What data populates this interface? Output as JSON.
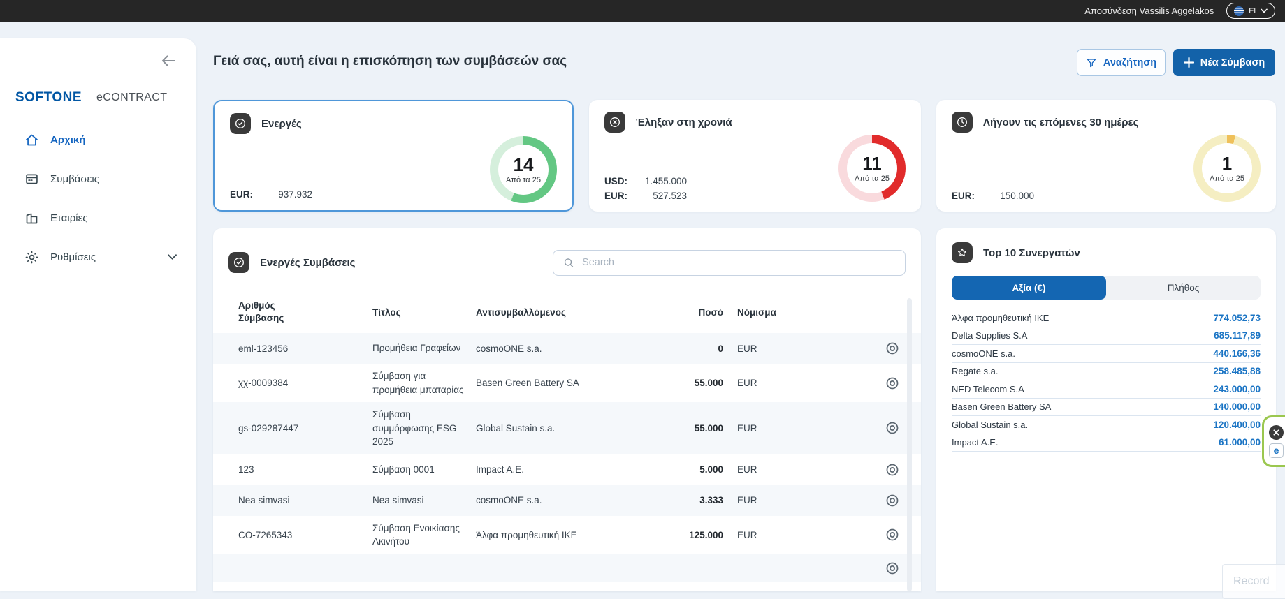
{
  "topbar": {
    "logout_label": "Αποσύνδεση Vassilis Aggelakos",
    "language": "El"
  },
  "sidebar": {
    "brand_name": "SOFTONE",
    "brand_product": "eCONTRACT",
    "items": [
      {
        "label": "Αρχική",
        "active": true
      },
      {
        "label": "Συμβάσεις",
        "active": false
      },
      {
        "label": "Εταιρίες",
        "active": false
      },
      {
        "label": "Ρυθμίσεις",
        "active": false
      }
    ]
  },
  "header": {
    "greeting": "Γειά σας, αυτή είναι η επισκόπηση των συμβάσεών σας",
    "search_button": "Αναζήτηση",
    "new_contract_button": "Νέα Σύμβαση"
  },
  "cards": [
    {
      "title": "Ενεργές",
      "count": "14",
      "of_label": "Από τα 25",
      "percent": 56,
      "ring_color": "#63c783",
      "ring_bg": "#d5efdc",
      "amounts": [
        {
          "currency": "EUR:",
          "value": "937.932"
        }
      ]
    },
    {
      "title": "Έληξαν στη χρονιά",
      "count": "11",
      "of_label": "Από τα 25",
      "percent": 44,
      "ring_color": "#e12b2b",
      "ring_bg": "#f9dadd",
      "amounts": [
        {
          "currency": "USD:",
          "value": "1.455.000"
        },
        {
          "currency": "EUR:",
          "value": "527.523"
        }
      ]
    },
    {
      "title": "Λήγουν τις επόμενες 30 ημέρες",
      "count": "1",
      "of_label": "Από τα 25",
      "percent": 4,
      "ring_color": "#efc05a",
      "ring_bg": "#f5eec2",
      "amounts": [
        {
          "currency": "EUR:",
          "value": "150.000"
        }
      ]
    }
  ],
  "table": {
    "title": "Ενεργές Συμβάσεις",
    "search_placeholder": "Search",
    "columns": {
      "number": "Αριθμός Σύμβασης",
      "title": "Τίτλος",
      "counterparty": "Αντισυμβαλλόμενος",
      "amount": "Ποσό",
      "currency": "Νόμισμα"
    },
    "rows": [
      {
        "number": "eml-123456",
        "title": "Προμήθεια Γραφείων",
        "counterparty": "cosmoONE s.a.",
        "amount": "0",
        "currency": "EUR"
      },
      {
        "number": "χχ-0009384",
        "title": "Σύμβαση για προμήθεια μπαταρίας",
        "counterparty": "Basen Green Battery SA",
        "amount": "55.000",
        "currency": "EUR"
      },
      {
        "number": "gs-029287447",
        "title": "Σύμβαση συμμόρφωσης ESG 2025",
        "counterparty": "Global Sustain s.a.",
        "amount": "55.000",
        "currency": "EUR"
      },
      {
        "number": "123",
        "title": "Σύμβαση 0001",
        "counterparty": "Impact A.E.",
        "amount": "5.000",
        "currency": "EUR"
      },
      {
        "number": "Nea simvasi",
        "title": "Nea simvasi",
        "counterparty": "cosmoONE s.a.",
        "amount": "3.333",
        "currency": "EUR"
      },
      {
        "number": "CO-7265343",
        "title": "Σύμβαση Ενοικίασης Ακινήτου",
        "counterparty": "Άλφα προμηθευτική ΙΚΕ",
        "amount": "125.000",
        "currency": "EUR"
      }
    ]
  },
  "top10": {
    "title": "Top 10 Συνεργατών",
    "tabs": [
      {
        "label": "Αξία (€)",
        "active": true
      },
      {
        "label": "Πλήθος",
        "active": false
      }
    ],
    "rows": [
      {
        "name": "Άλφα προμηθευτική ΙΚΕ",
        "value": "774.052,73"
      },
      {
        "name": "Delta Supplies S.A",
        "value": "685.117,89"
      },
      {
        "name": "cosmoONE s.a.",
        "value": "440.166,36"
      },
      {
        "name": "Regate s.a.",
        "value": "258.485,88"
      },
      {
        "name": "NED Telecom S.A",
        "value": "243.000,00"
      },
      {
        "name": "Basen Green Battery SA",
        "value": "140.000,00"
      },
      {
        "name": "Global Sustain s.a.",
        "value": "120.400,00"
      },
      {
        "name": "Impact A.E.",
        "value": "61.000,00"
      }
    ]
  },
  "overlays": {
    "record_label": "Record",
    "widget_logo": "e"
  }
}
